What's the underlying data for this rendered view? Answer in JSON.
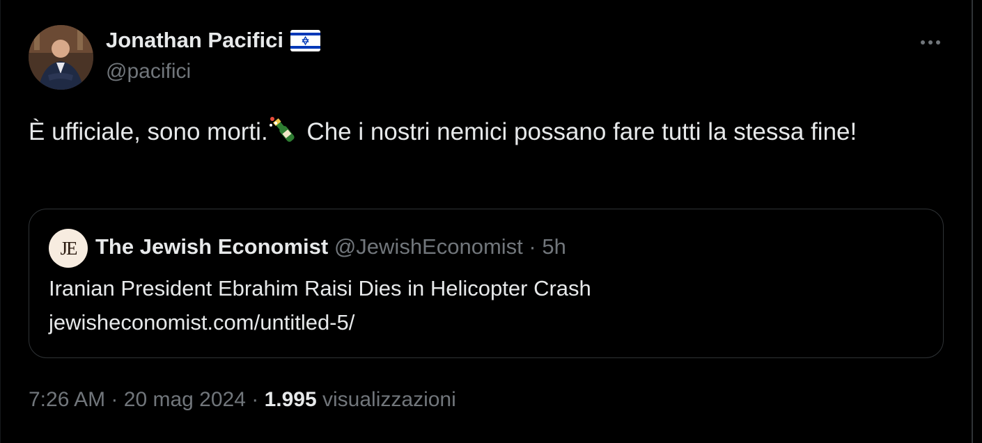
{
  "author": {
    "name": "Jonathan Pacifici",
    "handle": "@pacifici",
    "flag_icon": "israel-flag-icon"
  },
  "tweet": {
    "text_before": "È ufficiale, sono morti.",
    "emoji_icon": "champagne-bottle-icon",
    "text_after": " Che i nostri nemici possano fare tutti la stessa fine!"
  },
  "quote": {
    "avatar_initials": "JE",
    "name": "The Jewish Economist",
    "handle": "@JewishEconomist",
    "separator": "·",
    "time": "5h",
    "title": "Iranian President Ebrahim Raisi Dies in Helicopter Crash",
    "link": "jewisheconomist.com/untitled-5/"
  },
  "meta": {
    "time": "7:26 AM",
    "separator": "·",
    "date": "20 mag 2024",
    "separator2": "·",
    "views_count": "1.995",
    "views_label": "visualizzazioni"
  },
  "colors": {
    "background": "#000000",
    "text": "#e7e9ea",
    "secondary": "#71767b",
    "border": "#2f3336",
    "flag_blue": "#0038b8"
  }
}
